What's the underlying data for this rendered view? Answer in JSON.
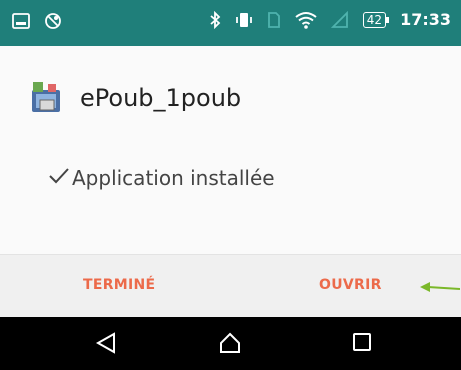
{
  "status_bar": {
    "battery_level": "42",
    "time": "17:33"
  },
  "dialog": {
    "app_name": "ePoub_1poub",
    "status_message": "Application installée",
    "buttons": {
      "done_label": "TERMINÉ",
      "open_label": "OUVRIR"
    }
  },
  "colors": {
    "status_bar": "#1f7f7a",
    "button_text": "#ec6a4a",
    "arrow": "#7bb82a",
    "nav_bar": "#000000"
  },
  "icons": {
    "status_left": [
      "image-notification-icon",
      "blocked-notification-icon"
    ],
    "status_right": [
      "bluetooth-icon",
      "vibrate-icon",
      "no-sim-icon",
      "wifi-icon",
      "no-signal-icon",
      "battery-icon"
    ],
    "navigation": [
      "back-icon",
      "home-icon",
      "recent-apps-icon"
    ]
  }
}
